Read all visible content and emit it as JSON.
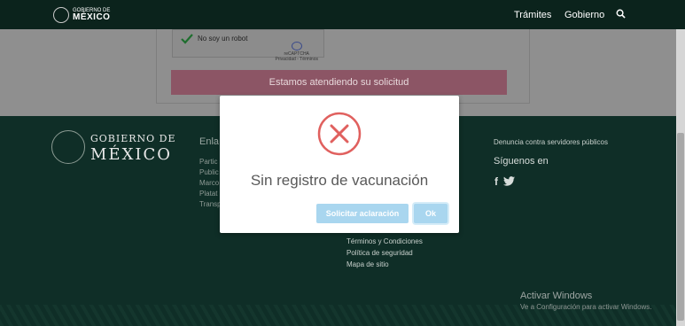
{
  "header": {
    "logo_line1": "GOBIERNO DE",
    "logo_line2": "MÉXICO",
    "nav": [
      "Trámites",
      "Gobierno"
    ],
    "search_icon": "search-icon"
  },
  "captcha": {
    "label": "No soy un robot",
    "brand": "reCAPTCHA",
    "links": "Privacidad - Términos"
  },
  "form": {
    "wait_button": "Estamos atendiendo su solicitud"
  },
  "footer": {
    "logo_line1": "GOBIERNO DE",
    "logo_line2": "MÉXICO",
    "links_heading": "Enla",
    "left_links": [
      "Partic",
      "Public",
      "Marco",
      "Platat",
      "Transp"
    ],
    "right_links": [
      "Términos y Condiciones",
      "Política de seguridad",
      "Mapa de sitio"
    ],
    "denuncia": "Denuncia contra servidores públicos",
    "social_heading": "Síguenos en",
    "social_icons": [
      "facebook-icon",
      "twitter-icon"
    ]
  },
  "windows": {
    "activate_title": "Activar Windows",
    "activate_sub": "Ve a Configuración para activar Windows."
  },
  "modal": {
    "title": "Sin registro de vacunación",
    "clarify_button": "Solicitar aclaración",
    "ok_button": "Ok",
    "icon": "error-x-icon",
    "accent": "#e0605e"
  }
}
